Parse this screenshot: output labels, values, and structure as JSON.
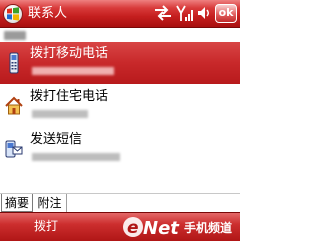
{
  "window": {
    "title": "联系人",
    "ok_label": "ok"
  },
  "status_icons": [
    "connectivity-icon",
    "signal-icon",
    "volume-icon"
  ],
  "contact": {
    "name": ""
  },
  "actions": [
    {
      "label": "拨打移动电话",
      "icon": "mobile-phone-icon",
      "selected": true
    },
    {
      "label": "拨打住宅电话",
      "icon": "home-icon",
      "selected": false
    },
    {
      "label": "发送短信",
      "icon": "sms-icon",
      "selected": false
    }
  ],
  "tabs": [
    {
      "label": "摘要",
      "active": true
    },
    {
      "label": "附注",
      "active": false
    }
  ],
  "softkeys": {
    "left": "拨打"
  },
  "watermark": {
    "brand": "eNet",
    "cn": "手机频道"
  },
  "colors": {
    "accent": "#c8282a",
    "selection": "#c8282a",
    "bar_dark": "#a80f0f"
  }
}
